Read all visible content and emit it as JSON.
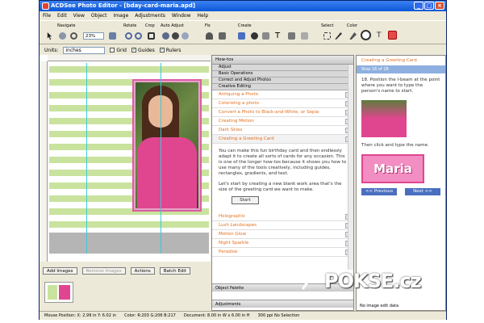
{
  "window": {
    "title": "ACDSee Photo Editor - [bday-card-maria.apd]"
  },
  "menu": [
    "File",
    "Edit",
    "View",
    "Object",
    "Image",
    "Adjustments",
    "Window",
    "Help"
  ],
  "toolbar": {
    "groups": [
      "Navigate",
      "Rotate",
      "Crop",
      "Auto Adjust",
      "Fix",
      "Create",
      "Select",
      "Color"
    ],
    "zoom": "23%"
  },
  "options": {
    "units_label": "Units:",
    "units_value": "inches",
    "grid_label": "Grid",
    "guides_label": "Guides",
    "rulers_label": "Rulers"
  },
  "bottom": {
    "add_images": "Add Images",
    "remove_images": "Remove Images",
    "actions": "Actions",
    "batch_edit": "Batch Edit"
  },
  "status": {
    "mouse": "Mouse Position: X: 2.99 in   Y: 6.02 in",
    "color": "Color: R:203 G:206 B:217",
    "document": "Document: 8.00 in W x 6.00 in H",
    "dpi": "300 ppi  No Selection"
  },
  "howto": {
    "title": "How-tos",
    "sections": [
      "Adjust",
      "Basic Operations",
      "Correct and Adjust Photos",
      "Creative Editing"
    ],
    "items_top": [
      "Antiquing a Photo",
      "Colorizing a photo",
      "Convert a Photo to Black-and-White, or Sepia",
      "Creating Motion",
      "Dark Skies",
      "Creating a Greeting Card"
    ],
    "description_1": "You can make this fun birthday card and then endlessly adapt it to create all sorts of cards for any occasion. This is one of the longer how-tos because it shows you how to use many of the tools creatively, including guides, rectangles, gradients, and text.",
    "description_2": "Let's start by creating a new blank work area that's the size of the greeting card we want to make.",
    "start": "Start",
    "items_bottom": [
      "Holographic",
      "Lush Landscapes",
      "Motion Glow",
      "Night Sparkle",
      "Paradise"
    ],
    "object_palette": "Object Palette",
    "adjustments": "Adjustments"
  },
  "right": {
    "title": "Creating a Greeting Card",
    "step": "Step 16 of 28",
    "instruction": "18. Position the I-beam at the point where you want to type the person's name to start.",
    "instruction_2": "Then click and type the name.",
    "name": "Maria",
    "previous": "<< Previous",
    "next": "Next >>",
    "status": "No image edit data"
  },
  "watermark": "POKSE.cz",
  "colors": {
    "title_bar": "#0b57d6",
    "accent": "#e07020",
    "card_stripe": "#c9e39e",
    "pink": "#e0468f"
  }
}
